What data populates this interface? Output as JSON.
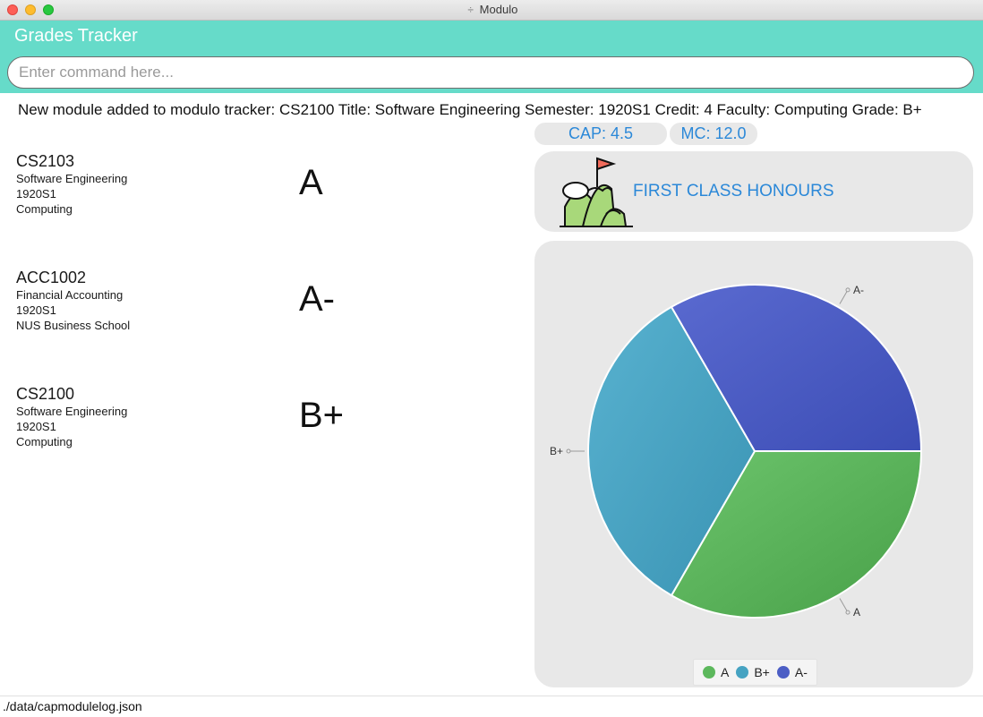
{
  "window": {
    "title": "Modulo"
  },
  "app": {
    "title": "Grades Tracker"
  },
  "command": {
    "placeholder": "Enter command here...",
    "value": ""
  },
  "result_message": "New module added to modulo tracker: CS2100 Title: Software Engineering Semester: 1920S1 Credit: 4 Faculty: Computing Grade: B+",
  "modules": [
    {
      "code": "CS2103",
      "title": "Software Engineering",
      "semester": "1920S1",
      "faculty": "Computing",
      "grade": "A"
    },
    {
      "code": "ACC1002",
      "title": "Financial Accounting",
      "semester": "1920S1",
      "faculty": "NUS Business School",
      "grade": "A-"
    },
    {
      "code": "CS2100",
      "title": "Software Engineering",
      "semester": "1920S1",
      "faculty": "Computing",
      "grade": "B+"
    }
  ],
  "stats": {
    "cap": "CAP: 4.5",
    "mc": "MC: 12.0"
  },
  "classification": {
    "label": "FIRST CLASS HONOURS",
    "icon": "mountain-flag-icon"
  },
  "chart_data": {
    "type": "pie",
    "slices": [
      {
        "label": "A",
        "value": 1,
        "color": "#5cb85c"
      },
      {
        "label": "B+",
        "value": 1,
        "color": "#46a3c2"
      },
      {
        "label": "A-",
        "value": 1,
        "color": "#4c5ec5"
      }
    ],
    "legend": [
      "A",
      "B+",
      "A-"
    ],
    "legend_position": "bottom"
  },
  "status": {
    "path": "./data/capmodulelog.json"
  }
}
